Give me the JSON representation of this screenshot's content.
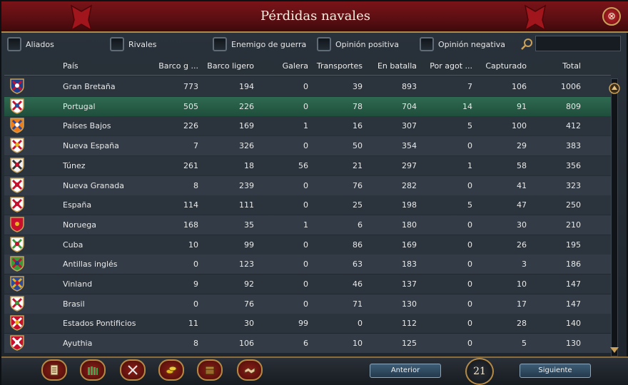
{
  "window": {
    "title": "Pérdidas navales",
    "close_glyph": "⊗"
  },
  "filters": [
    {
      "label": "Aliados"
    },
    {
      "label": "Rivales"
    },
    {
      "label": "Enemigo de guerra"
    },
    {
      "label": "Opinión positiva"
    },
    {
      "label": "Opinión negativa"
    }
  ],
  "search": {
    "value": ""
  },
  "table": {
    "headers": [
      "País",
      "Barco g ...",
      "Barco ligero",
      "Galera",
      "Transportes",
      "En batalla",
      "Por agot ...",
      "Capturado",
      "Total"
    ],
    "rows": [
      {
        "country": "Gran Bretaña",
        "vals": [
          "773",
          "194",
          "0",
          "39",
          "893",
          "7",
          "106",
          "1006"
        ],
        "flag": [
          "#1d3e8c",
          "#ffffff",
          "#c8102e"
        ],
        "flag_icon": "union-jack-flag"
      },
      {
        "country": "Portugal",
        "vals": [
          "505",
          "226",
          "0",
          "78",
          "704",
          "14",
          "91",
          "809"
        ],
        "flag": [
          "#ffffff",
          "#2156a6",
          "#c8102e"
        ],
        "flag_icon": "portugal-flag"
      },
      {
        "country": "Países Bajos",
        "vals": [
          "226",
          "169",
          "1",
          "16",
          "307",
          "5",
          "100",
          "412"
        ],
        "flag": [
          "#f07d18",
          "#ffffff",
          "#2a4b9b"
        ],
        "flag_icon": "netherlands-flag"
      },
      {
        "country": "Nueva España",
        "vals": [
          "7",
          "326",
          "0",
          "50",
          "354",
          "0",
          "29",
          "383"
        ],
        "flag": [
          "#ffffff",
          "#e6b420",
          "#c8102e"
        ],
        "flag_icon": "new-spain-flag"
      },
      {
        "country": "Túnez",
        "vals": [
          "261",
          "18",
          "56",
          "21",
          "297",
          "1",
          "58",
          "356"
        ],
        "flag": [
          "#f3f3f3",
          "#c8102e",
          "#333333"
        ],
        "flag_icon": "tunis-flag"
      },
      {
        "country": "Nueva  Granada",
        "vals": [
          "8",
          "239",
          "0",
          "76",
          "282",
          "0",
          "41",
          "323"
        ],
        "flag": [
          "#ffffff",
          "#c8102e",
          "#c8102e"
        ],
        "flag_icon": "new-granada-flag"
      },
      {
        "country": "España",
        "vals": [
          "114",
          "111",
          "0",
          "25",
          "198",
          "5",
          "47",
          "250"
        ],
        "flag": [
          "#ffffff",
          "#c8102e",
          "#c8102e"
        ],
        "flag_icon": "spain-flag"
      },
      {
        "country": "Noruega",
        "vals": [
          "168",
          "35",
          "1",
          "6",
          "180",
          "0",
          "30",
          "210"
        ],
        "flag": [
          "#c8102e",
          "#e6b420",
          "#c8102e"
        ],
        "flag_icon": "norway-flag"
      },
      {
        "country": "Cuba",
        "vals": [
          "10",
          "99",
          "0",
          "86",
          "169",
          "0",
          "26",
          "195"
        ],
        "flag": [
          "#ffffff",
          "#c8102e",
          "#3a9a3a"
        ],
        "flag_icon": "cuba-flag"
      },
      {
        "country": "Antillas inglés",
        "vals": [
          "0",
          "123",
          "0",
          "63",
          "183",
          "0",
          "3",
          "186"
        ],
        "flag": [
          "#3a9a3a",
          "#1d3e8c",
          "#c8102e"
        ],
        "flag_icon": "english-antilles-flag"
      },
      {
        "country": "Vinland",
        "vals": [
          "9",
          "92",
          "0",
          "46",
          "137",
          "0",
          "10",
          "147"
        ],
        "flag": [
          "#2a4b9b",
          "#c8102e",
          "#e6b420"
        ],
        "flag_icon": "vinland-flag"
      },
      {
        "country": "Brasil",
        "vals": [
          "0",
          "76",
          "0",
          "71",
          "130",
          "0",
          "17",
          "147"
        ],
        "flag": [
          "#ffffff",
          "#3a9a3a",
          "#c8102e"
        ],
        "flag_icon": "brazil-flag"
      },
      {
        "country": "Estados Pontificios",
        "vals": [
          "11",
          "30",
          "99",
          "0",
          "112",
          "0",
          "28",
          "140"
        ],
        "flag": [
          "#c8102e",
          "#e6b420",
          "#ffffff"
        ],
        "flag_icon": "papal-states-flag"
      },
      {
        "country": "Ayuthia",
        "vals": [
          "8",
          "106",
          "6",
          "10",
          "125",
          "0",
          "5",
          "130"
        ],
        "flag": [
          "#c8102e",
          "#ffffff",
          "#ffffff"
        ],
        "flag_icon": "ayutthaya-flag"
      }
    ]
  },
  "bottom": {
    "tabs": [
      {
        "icon": "scroll-icon"
      },
      {
        "icon": "army-icon"
      },
      {
        "icon": "crossed-swords-icon"
      },
      {
        "icon": "coins-icon"
      },
      {
        "icon": "chest-icon"
      },
      {
        "icon": "handshake-icon"
      }
    ],
    "prev_label": "Anterior",
    "next_label": "Siguiente",
    "page": "21"
  },
  "colors": {
    "title_bar": "#6e1014",
    "selected_row": "#2a5e49",
    "accent_gold": "#b68a44"
  }
}
